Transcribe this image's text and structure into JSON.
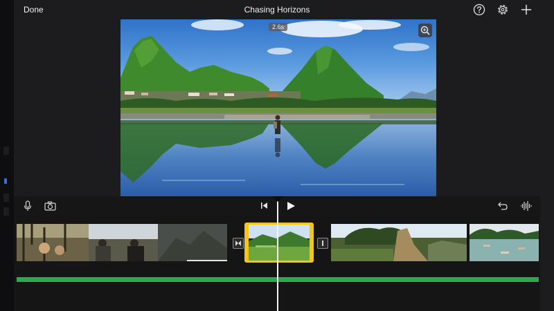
{
  "header": {
    "done_label": "Done",
    "project_title": "Chasing Horizons",
    "icons": [
      "help-icon",
      "settings-icon",
      "add-icon"
    ]
  },
  "viewer": {
    "duration_badge": "2.6s",
    "zoom_icon": "zoom-icon"
  },
  "toolbar": {
    "icons": [
      "microphone-icon",
      "camera-icon",
      "skip-to-start-icon",
      "play-icon",
      "undo-icon",
      "audio-waveform-icon"
    ]
  },
  "timeline": {
    "clips": [
      "hikers-forest-clip",
      "mountain-valley-clip",
      "tropical-landscape-clip",
      "river-boats-clip"
    ],
    "selected_clip": "green-valley-clip",
    "audio_track_color": "#2ea84d",
    "selection_color": "#f5c518"
  }
}
